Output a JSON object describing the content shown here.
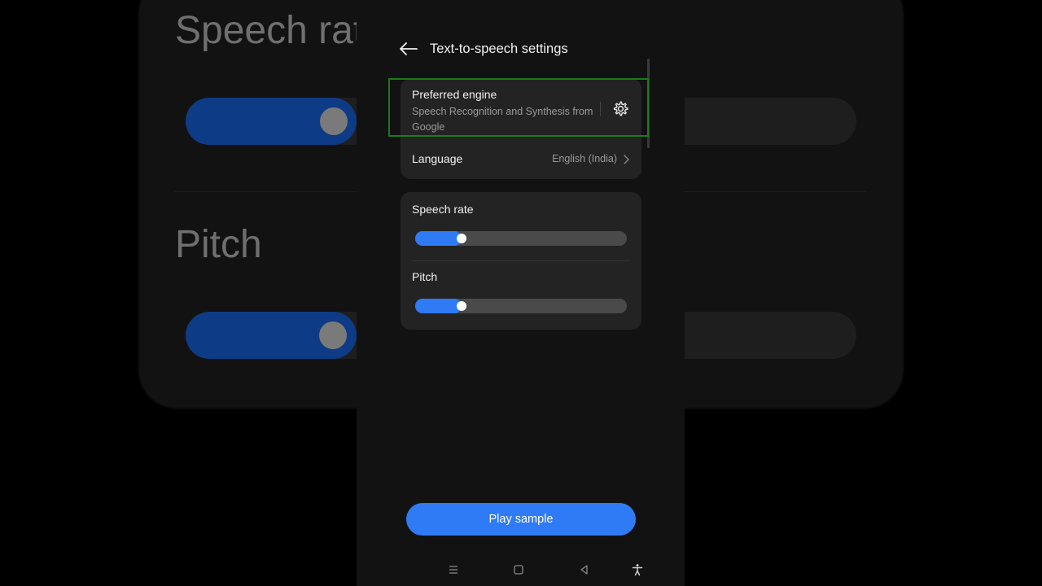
{
  "background": {
    "speech_rate_text": "Speech rat",
    "pitch_text": "Pitch"
  },
  "header": {
    "title": "Text-to-speech settings",
    "back_icon": "arrow-left-icon"
  },
  "engine": {
    "title": "Preferred engine",
    "subtitle": "Speech Recognition and Synthesis from Google",
    "settings_icon": "gear-icon",
    "highlight_color": "#1c7a1c"
  },
  "language": {
    "label": "Language",
    "value": "English (India)"
  },
  "sliders": {
    "speech_rate": {
      "label": "Speech rate",
      "value": 0.22
    },
    "pitch": {
      "label": "Pitch",
      "value": 0.22
    }
  },
  "play_sample": {
    "label": "Play sample"
  },
  "navbar": {
    "icons": [
      "menu-icon",
      "home-icon",
      "back-triangle-icon",
      "accessibility-icon"
    ]
  },
  "colors": {
    "accent": "#2f7bf5",
    "card": "#232323",
    "screen": "#121212"
  }
}
